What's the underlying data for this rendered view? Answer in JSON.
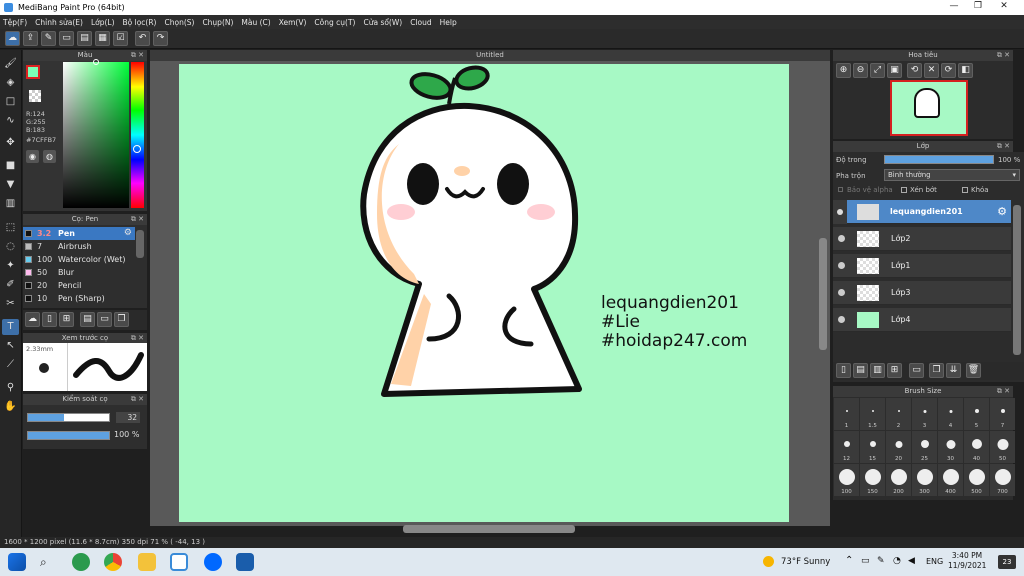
{
  "app": {
    "title": "MediBang Paint Pro (64bit)",
    "window_controls": [
      "—",
      "❐",
      "✕"
    ]
  },
  "menu": [
    "Tệp(F)",
    "Chỉnh sửa(E)",
    "Lớp(L)",
    "Bộ lọc(R)",
    "Chọn(S)",
    "Chụp(N)",
    "Màu (C)",
    "Xem(V)",
    "Công cụ(T)",
    "Cửa sổ(W)",
    "Cloud",
    "Help"
  ],
  "panels": {
    "color": {
      "title": "Màu",
      "r": "R:124",
      "g": "G:255",
      "b": "B:183",
      "hex": "#7CFFB7"
    },
    "brush": {
      "title": "Cọ: Pen",
      "items": [
        {
          "size": "3.2",
          "name": "Pen",
          "color": "#111111",
          "selected": true
        },
        {
          "size": "7",
          "name": "Airbrush",
          "color": "#bbbbbb"
        },
        {
          "size": "100",
          "name": "Watercolor (Wet)",
          "color": "#66ccee"
        },
        {
          "size": "50",
          "name": "Blur",
          "color": "#ffbbee"
        },
        {
          "size": "20",
          "name": "Pencil",
          "color": "#111111"
        },
        {
          "size": "10",
          "name": "Pen (Sharp)",
          "color": "#111111"
        }
      ]
    },
    "preview": {
      "title": "Xem trước cọ",
      "size": "2.33mm"
    },
    "control": {
      "title": "Kiểm soát cọ",
      "size_value": "32",
      "size_fill": 0.45,
      "opacity_value": "100 %",
      "opacity_fill": 1.0
    },
    "navigator": {
      "title": "Hoa tiêu"
    },
    "layer": {
      "title": "Lớp",
      "opacity_label": "Độ trong",
      "opacity_value": "100 %",
      "opacity_fill": 1.0,
      "blend_label": "Pha trộn",
      "blend_value": "Bình thường",
      "protect_alpha": "Bảo vệ alpha",
      "clipping": "Xén bớt",
      "lock": "Khóa",
      "layers": [
        {
          "name": "lequangdien201",
          "selected": true
        },
        {
          "name": "Lớp2"
        },
        {
          "name": "Lớp1"
        },
        {
          "name": "Lớp3"
        },
        {
          "name": "Lớp4"
        }
      ]
    },
    "brushsize": {
      "title": "Brush Size",
      "sizes": [
        "1",
        "1.5",
        "2",
        "3",
        "4",
        "5",
        "7",
        "12",
        "15",
        "20",
        "25",
        "30",
        "40",
        "50",
        "100",
        "150",
        "200",
        "300",
        "400",
        "500",
        "700"
      ]
    }
  },
  "canvas": {
    "tab": "Untitled",
    "text_lines": [
      "lequangdien201",
      "#Lie",
      "#hoidap247.com"
    ],
    "bg_color": "#a7f9c5"
  },
  "status": {
    "text": "1600 * 1200 pixel   (11.6 * 8.7cm)   350 dpi   71 %   ( -44, 13 )"
  },
  "taskbar": {
    "weather": "73°F  Sunny",
    "lang": "ENG",
    "time": "3:40 PM",
    "date": "11/9/2021",
    "notif": "23"
  }
}
